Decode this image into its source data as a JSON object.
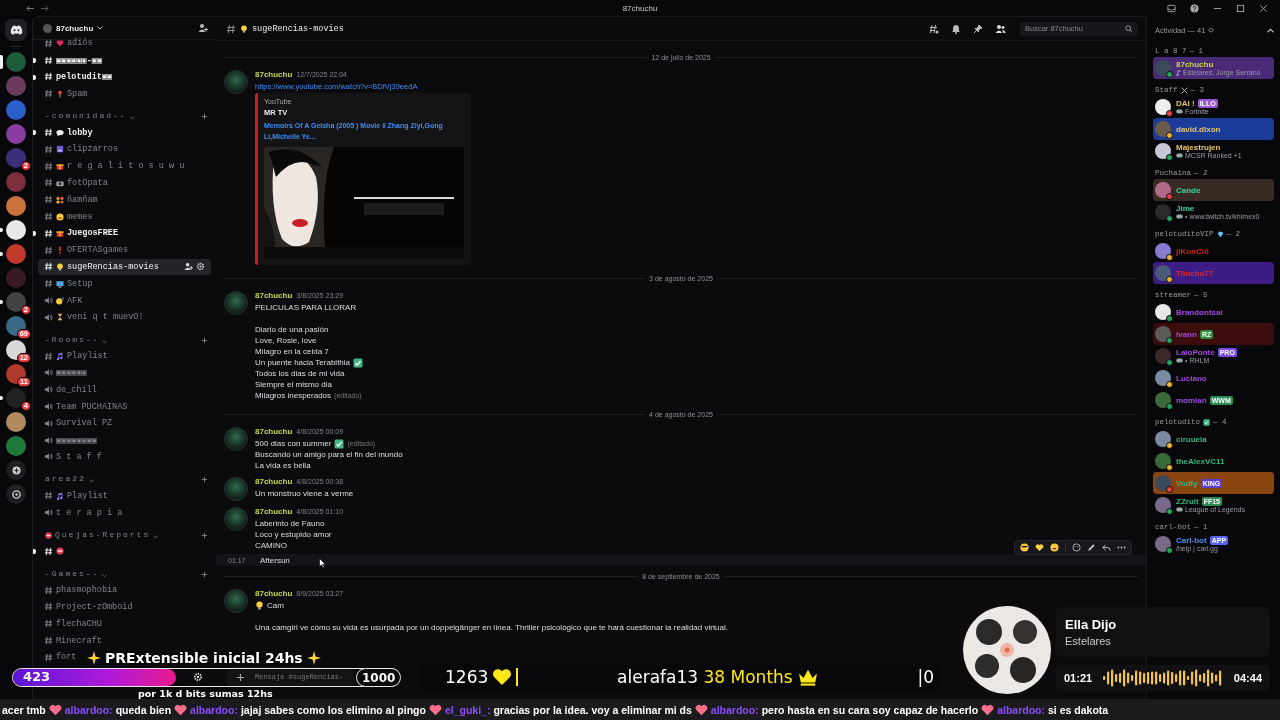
{
  "titlebar": {
    "title": "87chuchu"
  },
  "servers": [
    {
      "selected": true,
      "unread": false
    },
    {
      "selected": false,
      "unread": false
    },
    {
      "selected": false,
      "unread": false
    },
    {
      "selected": false,
      "unread": false
    },
    {
      "selected": false,
      "unread": false,
      "badge": "2"
    },
    {
      "selected": false,
      "unread": false
    },
    {
      "selected": false,
      "unread": false
    },
    {
      "selected": false,
      "unread": true
    },
    {
      "selected": false,
      "unread": true
    },
    {
      "selected": false,
      "unread": false
    },
    {
      "selected": false,
      "unread": true,
      "badge": "2"
    },
    {
      "selected": false,
      "unread": false,
      "badge": "69"
    },
    {
      "selected": false,
      "unread": false,
      "badge": "12"
    },
    {
      "selected": false,
      "unread": false,
      "badge": "11"
    },
    {
      "selected": false,
      "unread": true,
      "badge": "4"
    },
    {
      "selected": false,
      "unread": false
    },
    {
      "selected": false,
      "unread": false
    }
  ],
  "server_header": {
    "name": "87chuchu"
  },
  "channels": [
    {
      "kind": "text",
      "name": "adiós",
      "unread": false,
      "selected": false
    },
    {
      "kind": "text",
      "name": "▣▣▣▣▣▣-▣▣",
      "unread": true,
      "selected": false
    },
    {
      "kind": "text",
      "name": "pelotudit▣▣",
      "unread": true,
      "selected": false
    },
    {
      "kind": "text",
      "name": "Spam",
      "unread": false,
      "selected": false
    },
    {
      "kind": "category",
      "name": "-comunidad--"
    },
    {
      "kind": "text",
      "name": "lobby",
      "unread": true,
      "selected": false
    },
    {
      "kind": "text",
      "name": "clipzarros",
      "unread": false,
      "selected": false
    },
    {
      "kind": "text",
      "name": "r e g a l i t o s u w u",
      "unread": false,
      "selected": false
    },
    {
      "kind": "text",
      "name": "fotOpata",
      "unread": false,
      "selected": false
    },
    {
      "kind": "text",
      "name": "ñamñam",
      "unread": false,
      "selected": false
    },
    {
      "kind": "text",
      "name": "memes",
      "unread": false,
      "selected": false
    },
    {
      "kind": "text",
      "name": "JuegosFREE",
      "unread": true,
      "selected": false
    },
    {
      "kind": "text",
      "name": "OFERTASgames",
      "unread": false,
      "selected": false
    },
    {
      "kind": "text",
      "name": "sugeRencias-movies",
      "unread": false,
      "selected": true
    },
    {
      "kind": "text",
      "name": "Setup",
      "unread": false,
      "selected": false
    },
    {
      "kind": "voice",
      "name": "AFK",
      "unread": false,
      "selected": false
    },
    {
      "kind": "voice",
      "name": "veni q t muevO!",
      "unread": false,
      "selected": false
    },
    {
      "kind": "category",
      "name": "-Rooms--"
    },
    {
      "kind": "text",
      "name": "Playlist",
      "unread": false,
      "selected": false
    },
    {
      "kind": "voice",
      "name": "▣▣▣▣▣▣",
      "unread": false,
      "selected": false
    },
    {
      "kind": "voice",
      "name": "de_chill",
      "unread": false,
      "selected": false
    },
    {
      "kind": "voice",
      "name": "Team PUCHAINAS",
      "unread": false,
      "selected": false
    },
    {
      "kind": "voice",
      "name": "Survival PZ",
      "unread": false,
      "selected": false
    },
    {
      "kind": "voice",
      "name": "▣▣▣▣▣▣▣▣",
      "unread": false,
      "selected": false
    },
    {
      "kind": "voice",
      "name": "S t a f f",
      "unread": false,
      "selected": false
    },
    {
      "kind": "category",
      "name": "area22"
    },
    {
      "kind": "text",
      "name": "Playlist",
      "unread": false,
      "selected": false
    },
    {
      "kind": "voice",
      "name": "t e r a p i a",
      "unread": false,
      "selected": false
    },
    {
      "kind": "category",
      "name": "Quejas-Reports"
    },
    {
      "kind": "text",
      "unread": true,
      "selected": false
    },
    {
      "kind": "category",
      "name": "-Games--"
    },
    {
      "kind": "text",
      "name": "phasmophobia",
      "unread": false,
      "selected": false
    },
    {
      "kind": "text",
      "name": "Project-zOmboid",
      "unread": false,
      "selected": false
    },
    {
      "kind": "text",
      "name": "flechaCHU",
      "unread": false,
      "selected": false
    },
    {
      "kind": "text",
      "name": "Minecraft",
      "unread": false,
      "selected": false
    },
    {
      "kind": "text",
      "name": "fort",
      "unread": false,
      "selected": false
    }
  ],
  "chat_header": {
    "channel": "sugeRencias-movies",
    "search_placeholder": "Buscar 87chuchu"
  },
  "messages": [
    {
      "kind": "divider",
      "date": "12 de julio de 2025"
    },
    {
      "kind": "group",
      "author": "87chuchu",
      "time": "12/7/2025 22:04",
      "link": "https://www.youtube.com/watch?v=BDfVj39eedA",
      "embed": {
        "provider": "YouTube",
        "author": "MR TV",
        "title": "Memoirs Of A Geisha (2005 ) Movie ‖ Zhang Ziyi,Gong Li,Michelle Ye..."
      }
    },
    {
      "kind": "divider",
      "date": "3 de agosto de 2025"
    },
    {
      "kind": "group",
      "author": "87chuchu",
      "time": "3/8/2025 23:29",
      "paragraphs": [
        [
          {
            "text": "PELICULAS PARA LLORAR",
            "check": false
          }
        ],
        [
          {
            "text": "Diario de una pasión",
            "check": false
          },
          {
            "text": "Love, Rosie, love",
            "check": false
          },
          {
            "text": "Milagro en la celda 7",
            "check": false
          },
          {
            "text": "Un puente hacia Terabithia",
            "check": true
          },
          {
            "text": "Todos los dias de mi vida",
            "check": false
          },
          {
            "text": "Siempre el mismo dia",
            "check": false
          },
          {
            "text": "Milagros inesperados",
            "check": false,
            "edited": "(editado)"
          }
        ]
      ]
    },
    {
      "kind": "divider",
      "date": "4 de agosto de 2025"
    },
    {
      "kind": "group",
      "author": "87chuchu",
      "time": "4/8/2025 00:09",
      "paragraphs": [
        [
          {
            "text": "500 dias con summer",
            "check": true,
            "edited": "(editado)"
          },
          {
            "text": "Buscando un amigo para el fin del mundo",
            "check": false
          },
          {
            "text": "La vida es bella",
            "check": false
          }
        ]
      ]
    },
    {
      "kind": "group",
      "author": "87chuchu",
      "time": "4/8/2025 00:38",
      "paragraphs": [
        [
          {
            "text": "Un monstruo viene a verme",
            "check": false
          }
        ]
      ]
    },
    {
      "kind": "group",
      "author": "87chuchu",
      "time": "4/8/2025 01:10",
      "paragraphs": [
        [
          {
            "text": "Laberinto de Fauno",
            "check": false
          },
          {
            "text": "Loco y estupido amor",
            "check": false
          },
          {
            "text": "CAMINO",
            "check": false
          }
        ]
      ]
    },
    {
      "kind": "line",
      "time": "01:17",
      "text": "Aftersun",
      "hovered": true
    },
    {
      "kind": "divider",
      "date": "8 de septiembre de 2025"
    },
    {
      "kind": "group",
      "author": "87chuchu",
      "time": "8/9/2025 03:27",
      "paragraphs": [
        [
          {
            "text": "Cam",
            "check": false
          }
        ],
        [
          {
            "text": "Una camgirl ve cómo su vida es usurpada por un doppelgänger en línea. Thriller psicológico que te hará cuestionar la realidad virtual.",
            "check": false
          }
        ]
      ]
    }
  ],
  "composer": {
    "placeholder": "Mensaje #sugeRencias-"
  },
  "members": {
    "title": "Actividad — 41",
    "sections": [
      {
        "title": "L a 8 7",
        "count": "— 1",
        "members": [
          {
            "name": "87chuchu",
            "color": "#c9d94a",
            "kind": "online",
            "banner": {
              "color": "#4b2a78"
            },
            "activity": {
              "kind": "music",
              "text": "Estelares, Jorge Serrano"
            }
          }
        ]
      },
      {
        "title": "Staff",
        "count": "— 3",
        "members": [
          {
            "name": "DAI !",
            "color": "#e6c46e",
            "kind": "dnd",
            "tag": {
              "text": "ILLO",
              "color": "#9a58d0"
            },
            "activity": {
              "kind": "game",
              "text": "Fortnite"
            }
          },
          {
            "name": "david.dixon",
            "color": "#e6c46e",
            "kind": "idle",
            "banner": {
              "color": "#1d3c9a"
            }
          },
          {
            "name": "Majestrujen",
            "color": "#e6c46e",
            "kind": "online",
            "activity": {
              "kind": "game",
              "text": "MCSR Ranked +1"
            }
          }
        ]
      },
      {
        "title": "Puchaina",
        "count": "— 2",
        "members": [
          {
            "name": "Cande",
            "color": "#3fd1a6",
            "kind": "dnd",
            "banner": {
              "color": "#3a2a24"
            }
          },
          {
            "name": "Jime",
            "color": "#3fd1a6",
            "kind": "online",
            "activity": {
              "kind": "game",
              "text": "• www.twitch.tv/khimex0"
            }
          }
        ]
      },
      {
        "title": "pelotuditoVIP",
        "count": "— 2",
        "members": [
          {
            "name": "jIKonCio",
            "color": "#d41f1f",
            "kind": "idle"
          },
          {
            "name": "Tiincho77",
            "color": "#e02a2a",
            "kind": "idle",
            "banner": {
              "color": "#3d1c86"
            }
          }
        ]
      },
      {
        "title": "streamer",
        "count": "— 5",
        "members": [
          {
            "name": "Brandontsai",
            "color": "#a04ae0",
            "kind": "online"
          },
          {
            "name": "Ivann",
            "color": "#a04ae0",
            "kind": "online",
            "banner": {
              "color": "#3c0c0c"
            },
            "tag": {
              "text": "RZ",
              "color": "#2f8a3a"
            }
          },
          {
            "name": "LaloPonte",
            "color": "#a04ae0",
            "kind": "online",
            "tag": {
              "text": "PRO",
              "color": "#7a4ce0"
            },
            "activity": {
              "kind": "game",
              "text": "• RHLM"
            }
          },
          {
            "name": "Luciano",
            "color": "#a04ae0",
            "kind": "idle"
          },
          {
            "name": "momian",
            "color": "#a04ae0",
            "kind": "online",
            "tag": {
              "text": "WWM",
              "color": "#2e8b57"
            }
          }
        ]
      },
      {
        "title": "pelotudito",
        "count": "— 4",
        "members": [
          {
            "name": "ciruuela",
            "color": "#39b57e",
            "kind": "idle"
          },
          {
            "name": "theAlexVC11",
            "color": "#39b57e",
            "kind": "idle"
          },
          {
            "name": "Vodty",
            "color": "#39b57e",
            "kind": "dnd",
            "banner": {
              "color": "#8a4510"
            },
            "tag": {
              "text": "KING",
              "color": "#5b3fd0"
            }
          },
          {
            "name": "ZZruit",
            "color": "#39b57e",
            "kind": "online",
            "tag": {
              "text": "FF15",
              "color": "#2e8b57"
            },
            "activity": {
              "kind": "game",
              "text": "League of Legends"
            }
          }
        ]
      },
      {
        "title": "carl-bot",
        "count": "— 1",
        "members": [
          {
            "name": "Carl-bot",
            "color": "#4f8ff0",
            "kind": "online",
            "tag": {
              "text": "APP",
              "color": "#5865f2"
            },
            "activity": {
              "kind": "text",
              "text": "/help | carl.gg"
            }
          }
        ]
      }
    ]
  },
  "overlay": {
    "banner_text": "PRExtensible inicial 24hs",
    "bits": {
      "value": "423",
      "goal": "1000",
      "level": 0.423,
      "note": "por 1k d bits sumas 12hs"
    },
    "stats": {
      "count": "1263",
      "sub_user": "alerafa13",
      "sub_months": "38 Months",
      "zero": "|0"
    },
    "now_playing": {
      "title": "Ella Dijo",
      "artist": "Estelares",
      "elapsed": "01:21",
      "total": "04:44"
    },
    "ticker": [
      {
        "text": "acer tmb"
      },
      {
        "user": "albardoo:",
        "text": "queda bien"
      },
      {
        "user": "albardoo:",
        "text": "jajaj sabes como los elimino al pingo"
      },
      {
        "user": "el_guki_:",
        "text": "gracias por la idea. voy a eliminar mi ds"
      },
      {
        "user": "albardoo:",
        "text": "pero hasta en su cara soy capaz de hacerlo"
      },
      {
        "user": "albardoo:",
        "text": "si es dakota"
      }
    ]
  }
}
